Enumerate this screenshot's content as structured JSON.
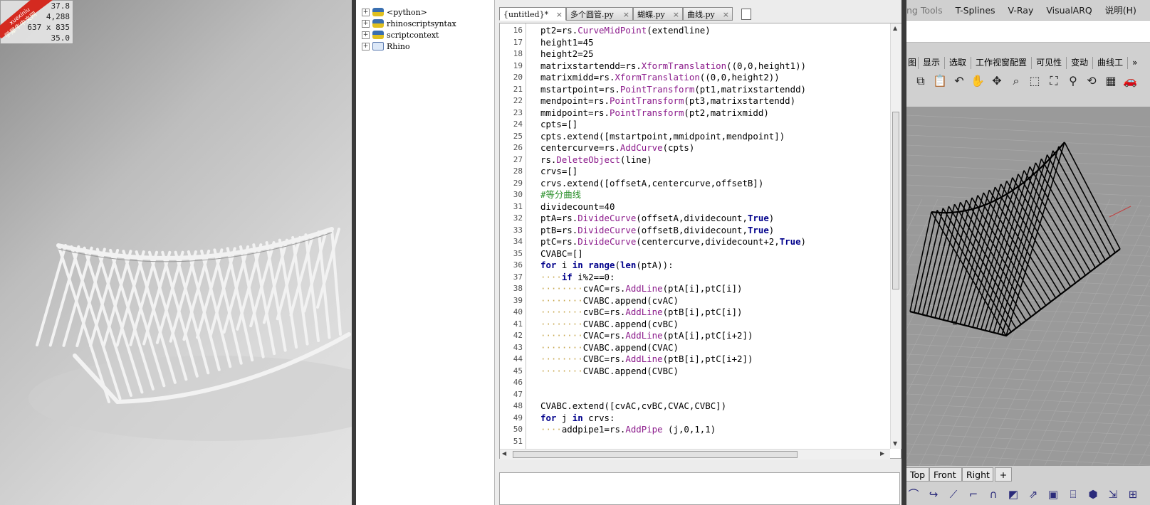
{
  "stats": {
    "rows": [
      "37.8",
      "4,288",
      "637 x 835",
      "35.0"
    ]
  },
  "logo": {
    "line1": "xuexiniu",
    "line2": "学犀牛中文网"
  },
  "tree": {
    "items": [
      "<python>",
      "rhinoscriptsyntax",
      "scriptcontext",
      "Rhino"
    ]
  },
  "tabs": [
    {
      "label": "{untitled}*",
      "active": true
    },
    {
      "label": "多个圆管.py",
      "active": false
    },
    {
      "label": "蝴蝶.py",
      "active": false
    },
    {
      "label": "曲线.py",
      "active": false
    }
  ],
  "line_numbers": [
    "16",
    "17",
    "18",
    "19",
    "20",
    "21",
    "22",
    "23",
    "24",
    "25",
    "26",
    "27",
    "28",
    "29",
    "30",
    "31",
    "32",
    "33",
    "34",
    "35",
    "36",
    "37",
    "38",
    "39",
    "40",
    "41",
    "42",
    "43",
    "44",
    "45",
    "46",
    "47",
    "48",
    "49",
    "50",
    "51"
  ],
  "code": [
    "pt2=rs.CurveMidPoint(extendline)",
    "height1=45",
    "height2=25",
    "matrixstartendd=rs.XformTranslation((0,0,height1))",
    "matrixmidd=rs.XformTranslation((0,0,height2))",
    "mstartpoint=rs.PointTransform(pt1,matrixstartendd)",
    "mendpoint=rs.PointTransform(pt3,matrixstartendd)",
    "mmidpoint=rs.PointTransform(pt2,matrixmidd)",
    "cpts=[]",
    "cpts.extend([mstartpoint,mmidpoint,mendpoint])",
    "centercurve=rs.AddCurve(cpts)",
    "rs.DeleteObject(line)",
    "crvs=[]",
    "crvs.extend([offsetA,centercurve,offsetB])",
    "#等分曲线",
    "dividecount=40",
    "ptA=rs.DivideCurve(offsetA,dividecount,True)",
    "ptB=rs.DivideCurve(offsetB,dividecount,True)",
    "ptC=rs.DivideCurve(centercurve,dividecount+2,True)",
    "CVABC=[]",
    "for i in range(len(ptA)):",
    "····if i%2==0:",
    "········cvAC=rs.AddLine(ptA[i],ptC[i])",
    "········CVABC.append(cvAC)",
    "········cvBC=rs.AddLine(ptB[i],ptC[i])",
    "········CVABC.append(cvBC)",
    "········CVAC=rs.AddLine(ptA[i],ptC[i+2])",
    "········CVABC.append(CVAC)",
    "········CVBC=rs.AddLine(ptB[i],ptC[i+2])",
    "········CVABC.append(CVBC)",
    "",
    "",
    "CVABC.extend([cvAC,cvBC,CVAC,CVBC])",
    "for j in crvs:",
    "····addpipe1=rs.AddPipe (j,0,1,1)",
    ""
  ],
  "rhino": {
    "menu": [
      "ng Tools",
      "T-Splines",
      "V-Ray",
      "VisualARQ",
      "说明(H)"
    ],
    "toolbar_tabs": [
      "图",
      "显示",
      "选取",
      "工作视窗配置",
      "可见性",
      "变动",
      "曲线工"
    ],
    "overflow": "»",
    "viewport_tabs": [
      "Top",
      "Front",
      "Right"
    ],
    "add_tab": "+"
  },
  "icons": {
    "toolbar": [
      "copy-icon",
      "paste-icon",
      "undo-icon",
      "pan-icon",
      "rotate-icon",
      "zoom-icon",
      "zoom-window-icon",
      "zoom-extents-icon",
      "zoom-selected-icon",
      "rotate-view-icon",
      "four-viewports-icon",
      "car-icon"
    ],
    "bottom": [
      "curve-icon",
      "blend-icon",
      "polyline-icon",
      "fillet-icon",
      "arc-icon",
      "surface-icon",
      "extrude-icon",
      "box-icon",
      "cylinder-icon",
      "solid-icon",
      "transform-icon",
      "mesh-icon"
    ]
  },
  "colors": {
    "keyword": "#00008b",
    "function": "#8b1a8b",
    "comment": "#228b22",
    "whitespace_marker": "#c8a850",
    "separator": "#3a3a3a"
  }
}
